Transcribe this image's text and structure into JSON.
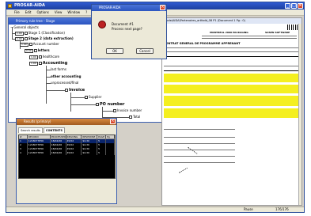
{
  "app": {
    "title": "PROSAR-AIDA"
  },
  "menu": [
    "File",
    "Edit",
    "Options",
    "View",
    "Window",
    "?"
  ],
  "tree_window": {
    "title": "Primary rule tree - Stage",
    "nodes": [
      {
        "label": "General objects"
      },
      {
        "label": "Stage 1 (Classification)",
        "num": "1.00"
      },
      {
        "label": "Stage 2 (data extraction)",
        "num": "1.00"
      },
      {
        "label": "Account number",
        "num": "1.00"
      },
      {
        "label": "letters",
        "num": "0.00"
      },
      {
        "label": "healthcare",
        "num": "1.00"
      },
      {
        "label": "Accounting",
        "num": "1.00"
      },
      {
        "label": "last forms"
      },
      {
        "label": "other accounting"
      },
      {
        "label": "unprocessed/final"
      },
      {
        "label": "Invoice"
      },
      {
        "label": "Supplier"
      },
      {
        "label": "PO number"
      },
      {
        "label": "Invoice number"
      },
      {
        "label": "Total"
      }
    ]
  },
  "dialog": {
    "title": "PROSAR-AIDA",
    "line1": "Document #1",
    "line2": "Process next page?",
    "ok": "OK",
    "cancel": "Cancel"
  },
  "results": {
    "title": "Results (primary)",
    "tabs": [
      "Search results",
      "CONTENTS"
    ],
    "headers": [
      "#",
      "RECORD",
      "PROCESSED",
      "READING",
      "RESPONSE",
      "PAGE",
      "Pg"
    ],
    "rows": [
      [
        "1",
        "1218077856",
        "18/04/06",
        "45/02",
        "94.30",
        "5",
        ""
      ],
      [
        "2",
        "1218077856",
        "18/04/06",
        "45/02",
        "94.30",
        "5",
        ""
      ],
      [
        "3",
        "1218077856",
        "18/04/06",
        "45/02",
        "94.30",
        "5",
        ""
      ],
      [
        "4",
        "1218077856",
        "18/04/06",
        "45/02",
        "94.30",
        "5",
        ""
      ]
    ]
  },
  "document": {
    "path": "...ode/AIDA\\Partenaires_artfadd_08 P1 (Document 1 Pg : 0)",
    "header": "MONTREAL 2000 PACKAGING",
    "invoice_title": "CONTRAT GENERAL DE    PROGRAMME APPRENANT",
    "supplier": "SOSEN SOFTWARE"
  },
  "status": {
    "state": "Pause",
    "counter": "176/176"
  }
}
